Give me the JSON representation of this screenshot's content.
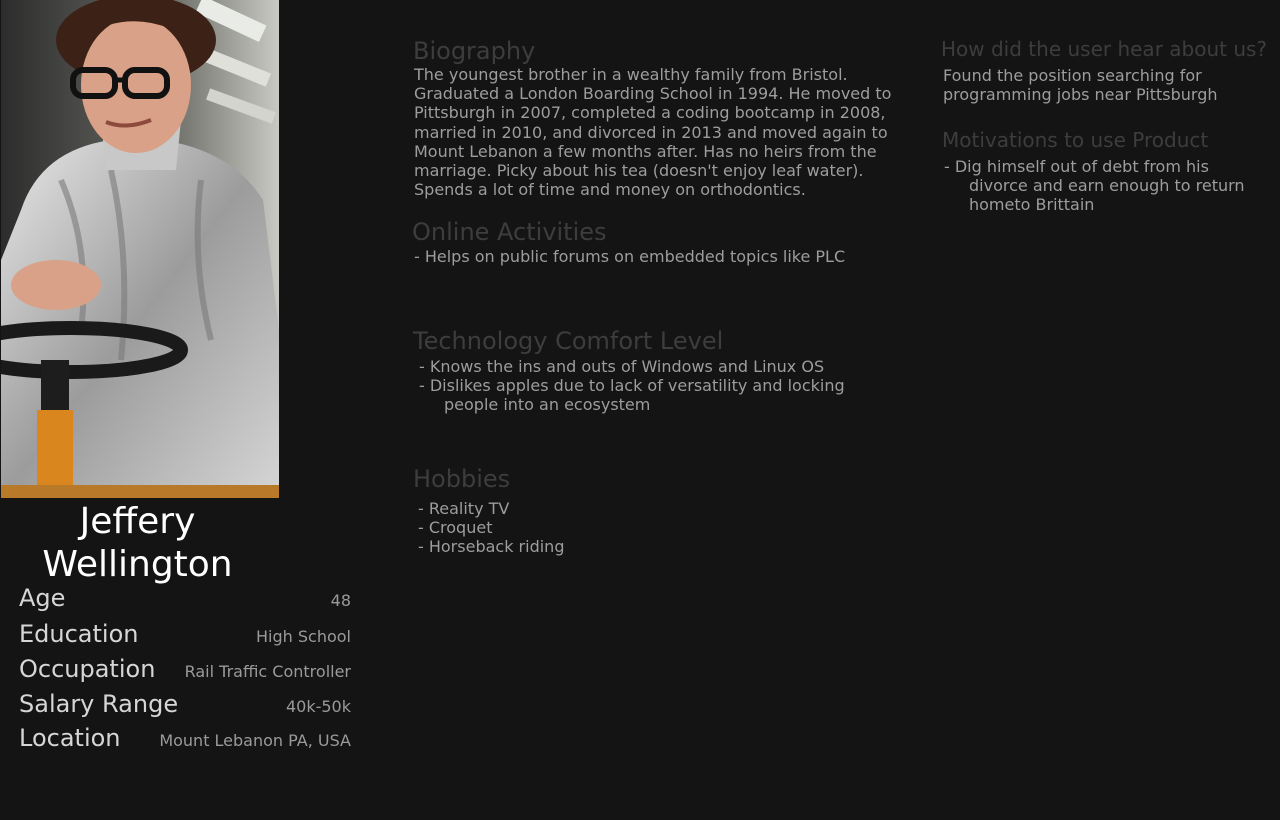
{
  "persona": {
    "name": "Jeffery Wellington",
    "facts": [
      {
        "label": "Age",
        "value": "48"
      },
      {
        "label": "Education",
        "value": "High School"
      },
      {
        "label": "Occupation",
        "value": "Rail Traffic Controller"
      },
      {
        "label": "Salary Range",
        "value": "40k-50k"
      },
      {
        "label": "Location",
        "value": "Mount Lebanon PA, USA"
      }
    ]
  },
  "biography": {
    "title": "Biography",
    "text": "The youngest brother in a wealthy family from Bristol. Graduated a London Boarding School in 1994. He moved to Pittsburgh in 2007, completed a coding bootcamp in 2008, married in 2010, and divorced in 2013 and moved again to Mount Lebanon a few months after. Has no heirs from the marriage. Picky about his tea (doesn't enjoy leaf water). Spends a lot of time and money on orthodontics."
  },
  "online_activities": {
    "title": "Online Activities",
    "items": [
      "- Helps on public forums on embedded topics like PLC"
    ]
  },
  "technology": {
    "title": "Technology Comfort Level",
    "items": [
      "- Knows the ins and outs of Windows and Linux OS",
      "- Dislikes apples due to lack of versatility and locking people into an ecosystem"
    ]
  },
  "hobbies": {
    "title": "Hobbies",
    "items": [
      "- Reality TV",
      "- Croquet",
      "- Horseback riding"
    ]
  },
  "hear_about": {
    "title": "How did the user hear about us?",
    "text": "Found the position searching for programming jobs near Pittsburgh"
  },
  "motivations": {
    "title": "Motivations to use Product",
    "items": [
      "- Dig himself out of debt from his divorce and earn enough to return hometo Brittain"
    ]
  }
}
